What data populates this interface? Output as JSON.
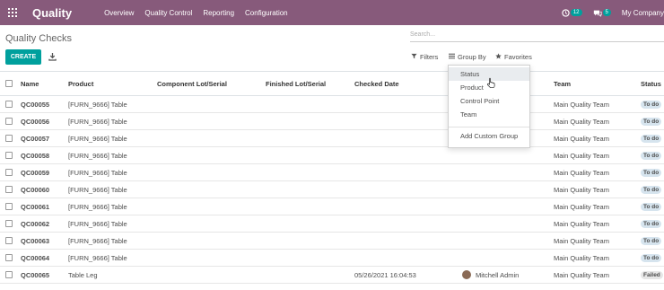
{
  "navbar": {
    "brand": "Quality",
    "menu": [
      "Overview",
      "Quality Control",
      "Reporting",
      "Configuration"
    ],
    "activity_count": "12",
    "message_count": "5",
    "company": "My Company"
  },
  "control_panel": {
    "title": "Quality Checks",
    "search_placeholder": "Search...",
    "create_label": "CREATE",
    "filters_label": "Filters",
    "groupby_label": "Group By",
    "favorites_label": "Favorites"
  },
  "table": {
    "columns": {
      "name": "Name",
      "product": "Product",
      "component_lot": "Component Lot/Serial",
      "finished_lot": "Finished Lot/Serial",
      "checked_date": "Checked Date",
      "team": "Team",
      "status": "Status"
    },
    "rows": [
      {
        "name": "QC00055",
        "product": "[FURN_9666] Table",
        "date": "",
        "responsible": "",
        "team": "Main Quality Team",
        "status": "To do"
      },
      {
        "name": "QC00056",
        "product": "[FURN_9666] Table",
        "date": "",
        "responsible": "",
        "team": "Main Quality Team",
        "status": "To do"
      },
      {
        "name": "QC00057",
        "product": "[FURN_9666] Table",
        "date": "",
        "responsible": "",
        "team": "Main Quality Team",
        "status": "To do"
      },
      {
        "name": "QC00058",
        "product": "[FURN_9666] Table",
        "date": "",
        "responsible": "",
        "team": "Main Quality Team",
        "status": "To do"
      },
      {
        "name": "QC00059",
        "product": "[FURN_9666] Table",
        "date": "",
        "responsible": "",
        "team": "Main Quality Team",
        "status": "To do"
      },
      {
        "name": "QC00060",
        "product": "[FURN_9666] Table",
        "date": "",
        "responsible": "",
        "team": "Main Quality Team",
        "status": "To do"
      },
      {
        "name": "QC00061",
        "product": "[FURN_9666] Table",
        "date": "",
        "responsible": "",
        "team": "Main Quality Team",
        "status": "To do"
      },
      {
        "name": "QC00062",
        "product": "[FURN_9666] Table",
        "date": "",
        "responsible": "",
        "team": "Main Quality Team",
        "status": "To do"
      },
      {
        "name": "QC00063",
        "product": "[FURN_9666] Table",
        "date": "",
        "responsible": "",
        "team": "Main Quality Team",
        "status": "To do"
      },
      {
        "name": "QC00064",
        "product": "[FURN_9666] Table",
        "date": "",
        "responsible": "",
        "team": "Main Quality Team",
        "status": "To do"
      },
      {
        "name": "QC00065",
        "product": "Table Leg",
        "date": "05/26/2021 16:04:53",
        "responsible": "Mitchell Admin",
        "team": "Main Quality Team",
        "status": "Failed"
      }
    ]
  },
  "groupby_menu": {
    "items": [
      "Status",
      "Product",
      "Control Point",
      "Team"
    ],
    "custom": "Add Custom Group"
  },
  "colors": {
    "navbar": "#875a7b",
    "primary": "#00a09d"
  }
}
